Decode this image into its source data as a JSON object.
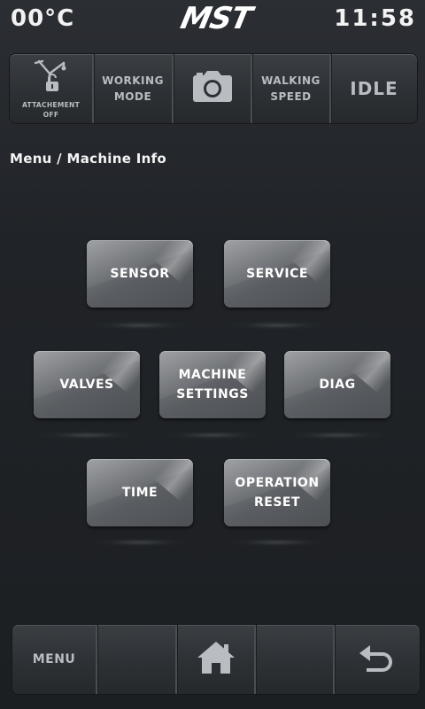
{
  "status": {
    "temperature": "00°C",
    "brand": "MST",
    "time": "11:58"
  },
  "top_toolbar": {
    "attachment": {
      "icon": "attachment-unlock-icon",
      "line1": "ATTACHEMENT",
      "line2": "OFF"
    },
    "working_mode": {
      "line1": "WORKING",
      "line2": "MODE"
    },
    "camera": {
      "icon": "camera-icon"
    },
    "walking_speed": {
      "line1": "WALKING",
      "line2": "SPEED"
    },
    "engine_state": "IDLE"
  },
  "breadcrumb": "Menu / Machine Info",
  "menu_buttons": {
    "sensor": {
      "line1": "SENSOR"
    },
    "service": {
      "line1": "SERVICE"
    },
    "valves": {
      "line1": "VALVES"
    },
    "machine_settings": {
      "line1": "MACHINE",
      "line2": "SETTINGS"
    },
    "diag": {
      "line1": "DIAG"
    },
    "time": {
      "line1": "TIME"
    },
    "operation_reset": {
      "line1": "OPERATION",
      "line2": "RESET"
    }
  },
  "bottom_toolbar": {
    "menu_label": "MENU",
    "home_icon": "home-icon",
    "back_icon": "back-arrow-icon"
  },
  "colors": {
    "background": "#202327",
    "toolbar": "#2d3034",
    "button": "#6e7175",
    "toolbar_text": "#b9bcc0",
    "text": "#ffffff"
  }
}
